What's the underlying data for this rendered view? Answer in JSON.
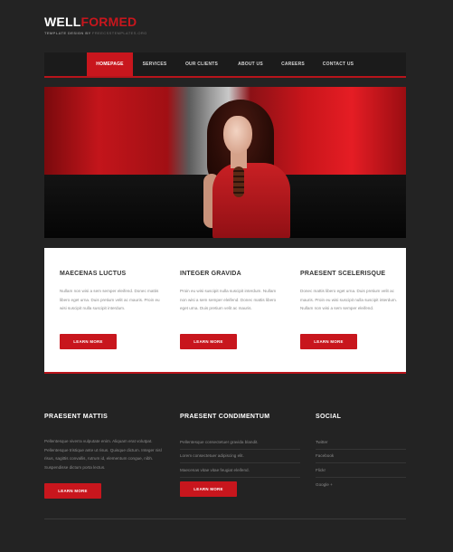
{
  "brand": {
    "logo_part1": "WELL",
    "logo_part2": "FORMED",
    "tagline": "TEMPLATE DESIGN BY",
    "tagline_link": "FREECSSTEMPLATES.ORG",
    "colors": {
      "accent": "#c8161d",
      "background": "#232323",
      "panel": "#ffffff"
    }
  },
  "nav": {
    "items": [
      {
        "label": "HOMEPAGE",
        "active": true
      },
      {
        "label": "SERVICES",
        "active": false
      },
      {
        "label": "OUR CLIENTS",
        "active": false
      },
      {
        "label": "ABOUT US",
        "active": false
      },
      {
        "label": "CAREERS",
        "active": false
      },
      {
        "label": "CONTACT US",
        "active": false
      }
    ]
  },
  "features": [
    {
      "title": "MAECENAS LUCTUS",
      "text": "Nullam non wisi a sem semper eleifend. Donec mattis libero eget urna. Duis pretium velit ac mauris. Proin eu wisi suscipit nulla suscipit interdum.",
      "button": "LEARN MORE"
    },
    {
      "title": "INTEGER GRAVIDA",
      "text": "Proin eu wisi suscipit nulla suscipit interdum. Nullam non wisi a sem semper eleifend. Donec mattis libero eget urna. Duis pretium velit ac mauris.",
      "button": "LEARN MORE"
    },
    {
      "title": "PRAESENT SCELERISQUE",
      "text": "Donec mattis libero eget urna. Duis pretium velit ac mauris. Proin eu wisi suscipit nulla suscipit interdum. Nullam non wisi a sem semper eleifend.",
      "button": "LEARN MORE"
    }
  ],
  "footer": {
    "col1": {
      "title": "PRAESENT MATTIS",
      "text": "Pellentesque viverra vulputate enim. Aliquam erat volutpat. Pellentesque tristique ante ut risus. Quisque dictum. Integer nisl risus, sagittis convallis, rutrum id, elementum congue, nibh. Suspendisse dictum porta lectus.",
      "button": "LEARN MORE"
    },
    "col2": {
      "title": "PRAESENT CONDIMENTUM",
      "items": [
        "Pellentesque consectetuer gravida blandit.",
        "Lorem consectetuer adipiscing elit.",
        "Maecenas vitae vitae feugiat eleifend."
      ],
      "button": "LEARN MORE"
    },
    "col3": {
      "title": "SOCIAL",
      "items": [
        "Twitter",
        "Facebook",
        "Flickr",
        "Google +"
      ]
    }
  }
}
